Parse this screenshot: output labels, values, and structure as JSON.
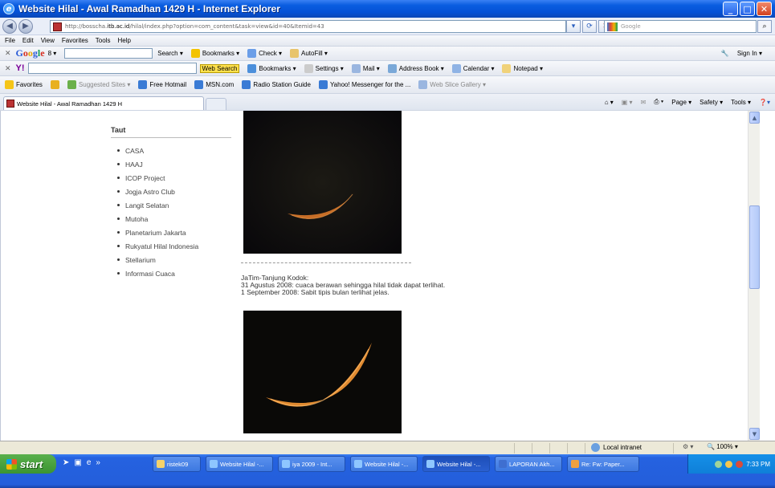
{
  "window": {
    "title": "Website Hilal - Awal Ramadhan 1429 H - Internet Explorer",
    "controls": [
      "_",
      "□",
      "✕"
    ]
  },
  "address_bar": {
    "url_prefix": "http://bosscha.",
    "url_host": "itb.ac.id",
    "url_rest": "/hilal/index.php?option=com_content&task=view&id=40&Itemid=43",
    "search_placeholder": "Google"
  },
  "menu": [
    "File",
    "Edit",
    "View",
    "Favorites",
    "Tools",
    "Help"
  ],
  "google_toolbar": {
    "logo": [
      "G",
      "o",
      "o",
      "g",
      "l",
      "e"
    ],
    "dropdown": "8 ▾",
    "items": [
      "Search ▾",
      "Bookmarks ▾",
      "Check ▾",
      "AutoFill ▾"
    ],
    "sign_in": "Sign In ▾"
  },
  "yahoo_toolbar": {
    "logo": "Y!",
    "web_search": "Web Search",
    "items": [
      "Bookmarks ▾",
      "Settings ▾",
      "Mail ▾",
      "Address Book ▾",
      "Calendar ▾",
      "Notepad ▾"
    ]
  },
  "favorites_bar": {
    "favorites_label": "Favorites",
    "items": [
      "Suggested Sites ▾",
      "Free Hotmail",
      "MSN.com",
      "Radio Station Guide",
      "Yahoo! Messenger for the ...",
      "Web Slice Gallery ▾"
    ]
  },
  "tab": {
    "label": "Website Hilal - Awal Ramadhan 1429 H",
    "commands": [
      "Page ▾",
      "Safety ▾",
      "Tools ▾"
    ]
  },
  "sidebar": {
    "heading": "Taut",
    "links": [
      "CASA",
      "HAAJ",
      "ICOP Project",
      "Jogja Astro Club",
      "Langit Selatan",
      "Mutoha",
      "Planetarium Jakarta",
      "Rukyatul Hilal Indonesia",
      "Stellarium",
      "Informasi Cuaca"
    ]
  },
  "article": {
    "caption_lines": [
      "JaTim-Tanjung Kodok:",
      "31 Agustus 2008: cuaca berawan sehingga hilal tidak dapat terlihat.",
      "1 September 2008: Sabit tipis bulan terlihat jelas."
    ]
  },
  "status_bar": {
    "zone": "Local intranet",
    "zoom": "100%"
  },
  "taskbar": {
    "start_label": "start",
    "buttons": [
      "ristek09",
      "Website Hilal -...",
      "iya 2009 - Int...",
      "Website Hilal -...",
      "Website Hilal -...",
      "LAPORAN Akh...",
      "Re: Fw: Paper..."
    ],
    "clock": "7:33 PM"
  },
  "colors": {
    "titlebar": "#0a5de0",
    "taskbar": "#245edb",
    "start_button": "#3b9432",
    "crescent": "#d9782a"
  }
}
